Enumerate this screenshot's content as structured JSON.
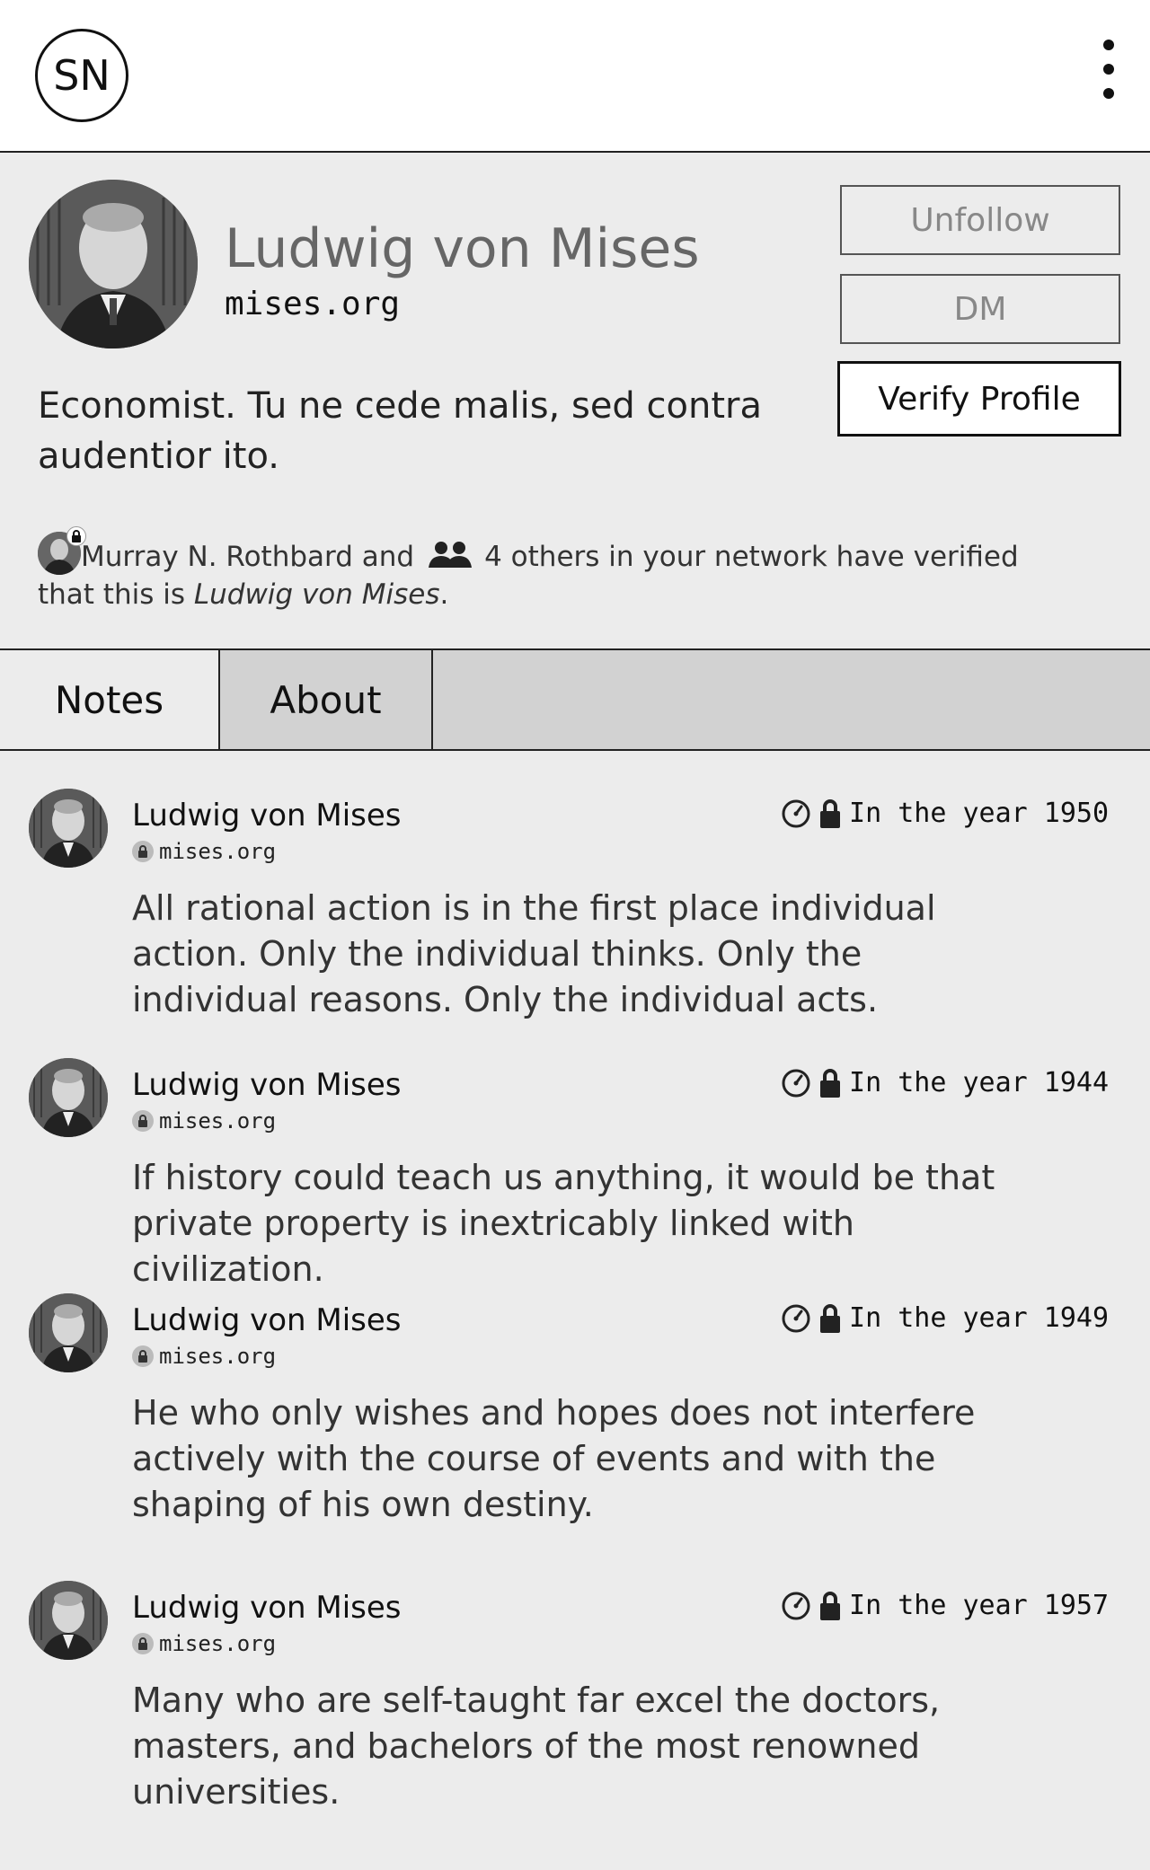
{
  "header": {
    "logo_text": "SN",
    "menu_icon": "more-vertical-icon"
  },
  "profile": {
    "name": "Ludwig von Mises",
    "domain": "mises.org",
    "bio": "Economist. Tu ne cede malis, sed contra audentior ito.",
    "buttons": {
      "unfollow": "Unfollow",
      "dm": "DM",
      "verify": "Verify Profile"
    },
    "verification": {
      "verifier": "Murray N. Rothbard",
      "and": "and",
      "others": "4 others in your network have verified",
      "that_this_is": "that this is",
      "subject": "Ludwig von Mises",
      "period": "."
    }
  },
  "tabs": [
    {
      "label": "Notes",
      "active": true
    },
    {
      "label": "About",
      "active": false
    }
  ],
  "notes": [
    {
      "author": "Ludwig von Mises",
      "domain": "mises.org",
      "time": "In the year 1950",
      "body": "All rational action is in the first place individual action. Only the individual thinks. Only the individual reasons. Only the individual acts."
    },
    {
      "author": "Ludwig von Mises",
      "domain": "mises.org",
      "time": "In the year 1944",
      "body": "If history could teach us anything, it would be that private property is inextricably linked with civilization."
    },
    {
      "author": "Ludwig von Mises",
      "domain": "mises.org",
      "time": "In the year 1949",
      "body": "He who only wishes and hopes does not interfere actively with the course of events and with the shaping of his own destiny."
    },
    {
      "author": "Ludwig von Mises",
      "domain": "mises.org",
      "time": "In the year 1957",
      "body": "Many who are self-taught far excel the doctors, masters, and bachelors of the most renowned universities."
    }
  ],
  "colors": {
    "background": "#ececec",
    "header_bg": "#ffffff",
    "tab_inactive": "#d2d2d2",
    "text": "#222222",
    "muted": "#666666"
  }
}
